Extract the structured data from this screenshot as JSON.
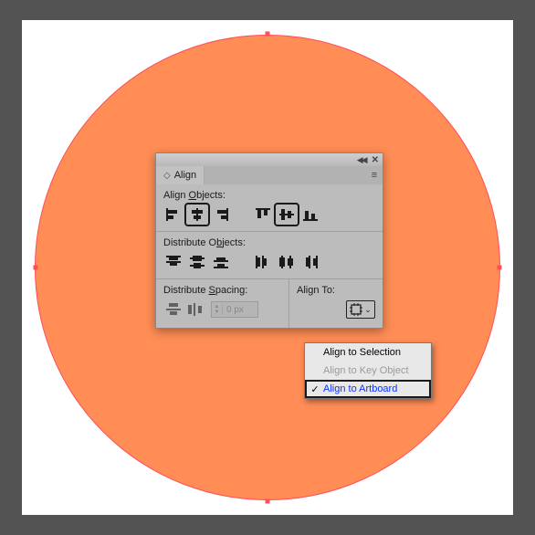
{
  "panel": {
    "title": "Align",
    "section_align_objects": "Align Objects:",
    "section_distribute_objects": "Distribute Objects:",
    "section_distribute_spacing": "Distribute Spacing:",
    "section_align_to": "Align To:",
    "spacing_value": "0 px"
  },
  "flyout": {
    "items": [
      {
        "label": "Align to Selection",
        "enabled": true,
        "checked": false,
        "focused": false
      },
      {
        "label": "Align to Key Object",
        "enabled": false,
        "checked": false,
        "focused": false
      },
      {
        "label": "Align to Artboard",
        "enabled": true,
        "checked": true,
        "focused": true
      }
    ]
  }
}
